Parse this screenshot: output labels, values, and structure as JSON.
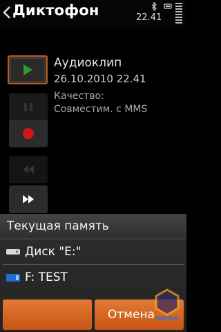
{
  "app": {
    "title": "Диктофон"
  },
  "status": {
    "time": "22.41"
  },
  "clip": {
    "title": "Аудиоклип",
    "datetime": "26.10.2010 22.41",
    "quality_label": "Качество:",
    "quality_value": "Совместим. с MMS"
  },
  "dialog": {
    "title": "Текущая память",
    "options": [
      {
        "label": "Диск \"E:\"",
        "icon": "disk-icon"
      },
      {
        "label": "F: TEST",
        "icon": "memory-card-icon"
      }
    ],
    "cancel_label": "Отмена"
  },
  "colors": {
    "accent": "#d5621f",
    "play_green": "#2e9e2e",
    "record_red": "#d01818"
  }
}
